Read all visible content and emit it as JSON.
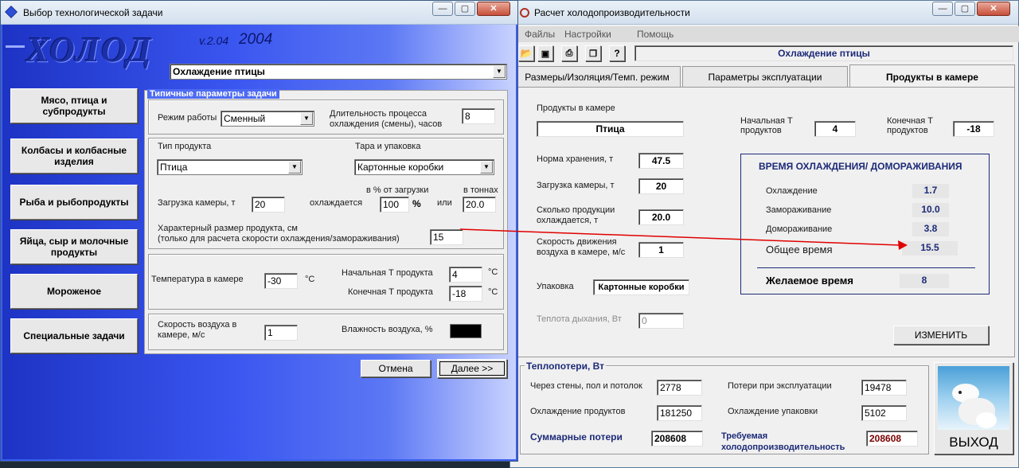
{
  "left_window": {
    "title": "Выбор технологической задачи",
    "logo": "ХОЛОД",
    "version": "v.2.04",
    "year": "2004",
    "task_select": "Охлаждение птицы",
    "categories": [
      "Мясо, птица и субпродукты",
      "Колбасы и колбасные изделия",
      "Рыба и рыбопродукты",
      "Яйца, сыр и молочные продукты",
      "Мороженое",
      "Специальные задачи"
    ],
    "group_title": "Типичные параметры задачи",
    "mode_label": "Режим работы",
    "mode_value": "Сменный",
    "duration_label": "Длительность процесса охлаждения (смены), часов",
    "duration_value": "8",
    "product_type_label": "Тип продукта",
    "product_type_value": "Птица",
    "pack_label": "Тара и упаковка",
    "pack_value": "Картонные коробки",
    "load_label": "Загрузка камеры, т",
    "load_value": "20",
    "pct_header": "в % от загрузки",
    "cooled_label": "охлаждается",
    "pct_value": "100",
    "pct_sign": "%",
    "or_label": "или",
    "tons_header": "в тоннах",
    "tons_value": "20.0",
    "size_label_1": "Характерный размер продукта, см",
    "size_label_2": "(только для расчета скорости охлаждения/замораживания)",
    "size_value": "15",
    "room_temp_label": "Температура в камере",
    "room_temp_value": "-30",
    "unit_c": "°C",
    "start_t_label": "Начальная Т продукта",
    "start_t_value": "4",
    "end_t_label": "Конечная Т продукта",
    "end_t_value": "-18",
    "air_speed_label": "Скорость воздуха в камере, м/с",
    "air_speed_value": "1",
    "humidity_label": "Влажность воздуха, %",
    "cancel": "Отмена",
    "next": "Далее >>"
  },
  "right_window": {
    "title": "Расчет холодопроизводительности",
    "menu": [
      "Файлы",
      "Настройки",
      "Помощь"
    ],
    "status_title": "Охлаждение птицы",
    "tabs": [
      "Размеры/Изоляция/Темп. режим",
      "Параметры эксплуатации",
      "Продукты в камере"
    ],
    "products_label": "Продукты в камере",
    "products_value": "Птица",
    "start_t_label": "Начальная Т продуктов",
    "start_t_value": "4",
    "end_t_label": "Конечная Т продуктов",
    "end_t_value": "-18",
    "storage_label": "Норма хранения, т",
    "storage_value": "47.5",
    "load_label": "Загрузка камеры, т",
    "load_value": "20",
    "cooled_label": "Сколько продукции охлаждается, т",
    "cooled_value": "20.0",
    "air_label": "Скорость движения воздуха в камере, м/с",
    "air_value": "1",
    "pack_label": "Упаковка",
    "pack_value": "Картонные коробки",
    "heat_label": "Теплота дыхания, Вт",
    "heat_value": "0",
    "time_box_title": "ВРЕМЯ ОХЛАЖДЕНИЯ/ ДОМОРАЖИВАНИЯ",
    "times": [
      {
        "label": "Охлаждение",
        "value": "1.7"
      },
      {
        "label": "Замораживание",
        "value": "10.0"
      },
      {
        "label": "Домораживание",
        "value": "3.8"
      }
    ],
    "total_label": "Общее время",
    "total_value": "15.5",
    "desired_label": "Желаемое время",
    "desired_value": "8",
    "change_button": "ИЗМЕНИТЬ",
    "losses_title": "Теплопотери, Вт",
    "walls_label": "Через стены, пол и потолок",
    "walls_value": "2778",
    "exploit_label": "Потери при эксплуатации",
    "exploit_value": "19478",
    "prod_cool_label": "Охлаждение продуктов",
    "prod_cool_value": "181250",
    "pack_cool_label": "Охлаждение упаковки",
    "pack_cool_value": "5102",
    "sum_label": "Суммарные потери",
    "sum_value": "208608",
    "required_label_1": "Требуемая",
    "required_label_2": "холодопроизводительность",
    "required_value": "208608",
    "exit_button": "ВЫХОД"
  },
  "colors": {
    "accent_red": "#e00000",
    "logo_blue": "#1b2fa8",
    "value_dark_red": "#7a0000",
    "group_blue": "#1c2a78"
  }
}
